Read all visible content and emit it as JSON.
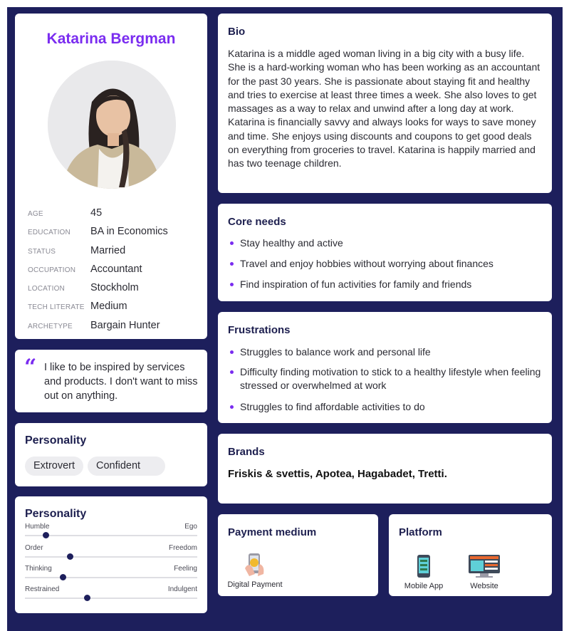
{
  "profile": {
    "name": "Katarina Bergman",
    "facts": [
      {
        "label": "AGE",
        "value": "45"
      },
      {
        "label": "EDUCATION",
        "value": "BA in Economics"
      },
      {
        "label": "STATUS",
        "value": "Married"
      },
      {
        "label": "OCCUPATION",
        "value": "Accountant"
      },
      {
        "label": "LOCATION",
        "value": "Stockholm"
      },
      {
        "label": "TECH LITERATE",
        "value": "Medium"
      },
      {
        "label": "ARCHETYPE",
        "value": "Bargain Hunter"
      }
    ]
  },
  "quote": {
    "mark": "“",
    "text": "I like to be inspired by services and products. I don't want to miss out on anything."
  },
  "personality_tags": {
    "title": "Personality",
    "tags": [
      "Extrovert",
      "Confident"
    ]
  },
  "personality_sliders": {
    "title": "Personality",
    "sliders": [
      {
        "left": "Humble",
        "right": "Ego",
        "value": 0.12
      },
      {
        "left": "Order",
        "right": "Freedom",
        "value": 0.26
      },
      {
        "left": "Thinking",
        "right": "Feeling",
        "value": 0.22
      },
      {
        "left": "Restrained",
        "right": "Indulgent",
        "value": 0.36
      }
    ]
  },
  "bio": {
    "title": "Bio",
    "text": "Katarina is a middle aged woman living in a big city with a busy life. She is a hard-working woman who has been working as an accountant for the past 30 years. She is passionate about staying fit and healthy and tries to exercise at least three times a week. She also loves to get massages as a way to relax and unwind after a long day at work. Katarina is financially savvy and always looks for ways to save money and time. She enjoys using discounts and coupons to get good deals on everything from groceries to travel. Katarina is happily married and has two teenage children."
  },
  "core_needs": {
    "title": "Core needs",
    "items": [
      "Stay healthy and active",
      "Travel and enjoy hobbies without worrying about finances",
      "Find inspiration of fun activities for family and friends"
    ]
  },
  "frustrations": {
    "title": "Frustrations",
    "items": [
      "Struggles to balance work and personal life",
      "Difficulty finding motivation to stick to a healthy lifestyle when feeling stressed or overwhelmed at work",
      "Struggles to find affordable activities to do"
    ]
  },
  "brands": {
    "title": "Brands",
    "text": "Friskis & svettis, Apotea,  Hagabadet, Tretti."
  },
  "payment": {
    "title": "Payment medium",
    "items": [
      {
        "label": "Digital Payment",
        "icon": "digital-payment-icon"
      }
    ]
  },
  "platform": {
    "title": "Platform",
    "items": [
      {
        "label": "Mobile App",
        "icon": "mobile-app-icon"
      },
      {
        "label": "Website",
        "icon": "website-icon"
      }
    ]
  },
  "colors": {
    "background": "#1d1f5c",
    "accent": "#7a2cf0",
    "heading": "#1d1f4f"
  }
}
